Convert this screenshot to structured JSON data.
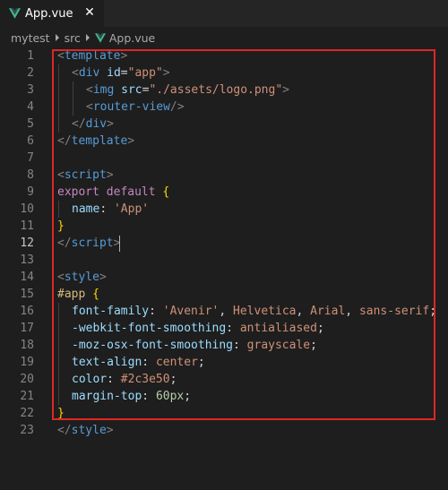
{
  "tab": {
    "label": "App.vue",
    "close_glyph": "✕",
    "icon": "vue-icon"
  },
  "breadcrumb": {
    "items": [
      "mytest",
      "src",
      "App.vue"
    ]
  },
  "editor": {
    "active_line": 12,
    "lines": [
      {
        "n": "1"
      },
      {
        "n": "2"
      },
      {
        "n": "3"
      },
      {
        "n": "4"
      },
      {
        "n": "5"
      },
      {
        "n": "6"
      },
      {
        "n": "7"
      },
      {
        "n": "8"
      },
      {
        "n": "9"
      },
      {
        "n": "10"
      },
      {
        "n": "11"
      },
      {
        "n": "12"
      },
      {
        "n": "13"
      },
      {
        "n": "14"
      },
      {
        "n": "15"
      },
      {
        "n": "16"
      },
      {
        "n": "17"
      },
      {
        "n": "18"
      },
      {
        "n": "19"
      },
      {
        "n": "20"
      },
      {
        "n": "21"
      },
      {
        "n": "22"
      },
      {
        "n": "23"
      }
    ],
    "code": {
      "l1": [
        "<",
        "template",
        ">"
      ],
      "l2": [
        "<",
        "div",
        " ",
        "id",
        "=",
        "\"app\"",
        ">"
      ],
      "l3": [
        "<",
        "img",
        " ",
        "src",
        "=",
        "\"./assets/logo.png\"",
        ">"
      ],
      "l4": [
        "<",
        "router-view",
        "/>"
      ],
      "l5": [
        "</",
        "div",
        ">"
      ],
      "l6": [
        "</",
        "template",
        ">"
      ],
      "l8": [
        "<",
        "script",
        ">"
      ],
      "l9": [
        "export",
        " ",
        "default",
        " ",
        "{"
      ],
      "l10": [
        "name",
        ": ",
        "'App'"
      ],
      "l11": [
        "}"
      ],
      "l12": [
        "</",
        "script",
        ">"
      ],
      "l14": [
        "<",
        "style",
        ">"
      ],
      "l15": [
        "#app",
        " ",
        "{"
      ],
      "l16": [
        "font-family",
        ": ",
        "'Avenir'",
        ", ",
        "Helvetica",
        ", ",
        "Arial",
        ", ",
        "sans-serif",
        ";"
      ],
      "l17": [
        "-webkit-font-smoothing",
        ": ",
        "antialiased",
        ";"
      ],
      "l18": [
        "-moz-osx-font-smoothing",
        ": ",
        "grayscale",
        ";"
      ],
      "l19": [
        "text-align",
        ": ",
        "center",
        ";"
      ],
      "l20": [
        "color",
        ": ",
        "#2c3e50",
        ";"
      ],
      "l21": [
        "margin-top",
        ": ",
        "60px",
        ";"
      ],
      "l22": [
        "}"
      ],
      "l23": [
        "</",
        "style",
        ">"
      ]
    }
  },
  "colors": {
    "highlight_border": "#e02626",
    "vue_green": "#41b883",
    "vue_dark": "#35495e"
  }
}
